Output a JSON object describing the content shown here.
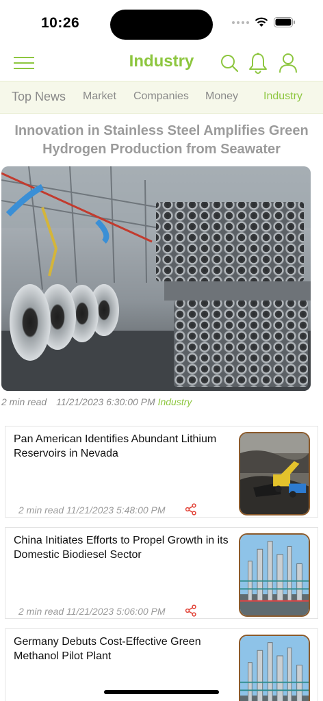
{
  "status_bar": {
    "time": "10:26"
  },
  "header": {
    "title": "Industry",
    "menu_icon": "hamburger-menu-icon",
    "search_icon": "search-icon",
    "bell_icon": "bell-icon",
    "user_icon": "user-icon",
    "accent": "#8dc63f"
  },
  "tabs": [
    {
      "label": "Top News"
    },
    {
      "label": "Market"
    },
    {
      "label": "Companies"
    },
    {
      "label": "Money"
    },
    {
      "label": "Industry",
      "active": true
    }
  ],
  "featured": {
    "title": "Innovation in Stainless Steel Amplifies Green Hydrogen Production from Seawater",
    "read_time": "2 min read",
    "date": "11/21/2023 6:30:00 PM",
    "category": "Industry"
  },
  "articles": [
    {
      "title": "Pan American Identifies Abundant Lithium Reservoirs in Nevada",
      "meta": "2 min read 11/21/2023 5:48:00 PM",
      "thumb": "mining-excavator"
    },
    {
      "title": "China Initiates Efforts to Propel Growth in its Domestic Biodiesel Sector",
      "meta": "2 min read 11/21/2023 5:06:00 PM",
      "thumb": "refinery"
    },
    {
      "title": "Germany Debuts Cost-Effective Green Methanol Pilot Plant",
      "meta": "",
      "thumb": "refinery"
    }
  ]
}
